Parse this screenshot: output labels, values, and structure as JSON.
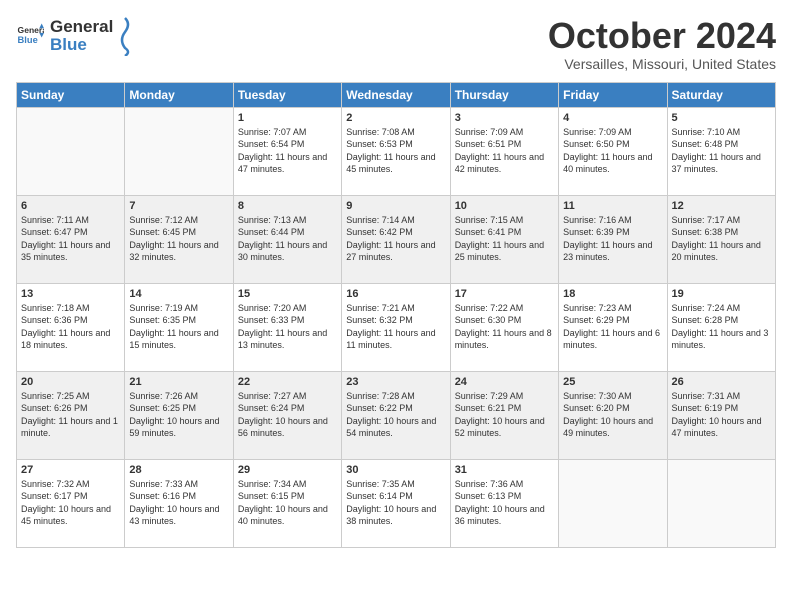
{
  "logo": {
    "general": "General",
    "blue": "Blue"
  },
  "title": "October 2024",
  "location": "Versailles, Missouri, United States",
  "headers": [
    "Sunday",
    "Monday",
    "Tuesday",
    "Wednesday",
    "Thursday",
    "Friday",
    "Saturday"
  ],
  "weeks": [
    [
      {
        "num": "",
        "sunrise": "",
        "sunset": "",
        "daylight": ""
      },
      {
        "num": "",
        "sunrise": "",
        "sunset": "",
        "daylight": ""
      },
      {
        "num": "1",
        "sunrise": "Sunrise: 7:07 AM",
        "sunset": "Sunset: 6:54 PM",
        "daylight": "Daylight: 11 hours and 47 minutes."
      },
      {
        "num": "2",
        "sunrise": "Sunrise: 7:08 AM",
        "sunset": "Sunset: 6:53 PM",
        "daylight": "Daylight: 11 hours and 45 minutes."
      },
      {
        "num": "3",
        "sunrise": "Sunrise: 7:09 AM",
        "sunset": "Sunset: 6:51 PM",
        "daylight": "Daylight: 11 hours and 42 minutes."
      },
      {
        "num": "4",
        "sunrise": "Sunrise: 7:09 AM",
        "sunset": "Sunset: 6:50 PM",
        "daylight": "Daylight: 11 hours and 40 minutes."
      },
      {
        "num": "5",
        "sunrise": "Sunrise: 7:10 AM",
        "sunset": "Sunset: 6:48 PM",
        "daylight": "Daylight: 11 hours and 37 minutes."
      }
    ],
    [
      {
        "num": "6",
        "sunrise": "Sunrise: 7:11 AM",
        "sunset": "Sunset: 6:47 PM",
        "daylight": "Daylight: 11 hours and 35 minutes."
      },
      {
        "num": "7",
        "sunrise": "Sunrise: 7:12 AM",
        "sunset": "Sunset: 6:45 PM",
        "daylight": "Daylight: 11 hours and 32 minutes."
      },
      {
        "num": "8",
        "sunrise": "Sunrise: 7:13 AM",
        "sunset": "Sunset: 6:44 PM",
        "daylight": "Daylight: 11 hours and 30 minutes."
      },
      {
        "num": "9",
        "sunrise": "Sunrise: 7:14 AM",
        "sunset": "Sunset: 6:42 PM",
        "daylight": "Daylight: 11 hours and 27 minutes."
      },
      {
        "num": "10",
        "sunrise": "Sunrise: 7:15 AM",
        "sunset": "Sunset: 6:41 PM",
        "daylight": "Daylight: 11 hours and 25 minutes."
      },
      {
        "num": "11",
        "sunrise": "Sunrise: 7:16 AM",
        "sunset": "Sunset: 6:39 PM",
        "daylight": "Daylight: 11 hours and 23 minutes."
      },
      {
        "num": "12",
        "sunrise": "Sunrise: 7:17 AM",
        "sunset": "Sunset: 6:38 PM",
        "daylight": "Daylight: 11 hours and 20 minutes."
      }
    ],
    [
      {
        "num": "13",
        "sunrise": "Sunrise: 7:18 AM",
        "sunset": "Sunset: 6:36 PM",
        "daylight": "Daylight: 11 hours and 18 minutes."
      },
      {
        "num": "14",
        "sunrise": "Sunrise: 7:19 AM",
        "sunset": "Sunset: 6:35 PM",
        "daylight": "Daylight: 11 hours and 15 minutes."
      },
      {
        "num": "15",
        "sunrise": "Sunrise: 7:20 AM",
        "sunset": "Sunset: 6:33 PM",
        "daylight": "Daylight: 11 hours and 13 minutes."
      },
      {
        "num": "16",
        "sunrise": "Sunrise: 7:21 AM",
        "sunset": "Sunset: 6:32 PM",
        "daylight": "Daylight: 11 hours and 11 minutes."
      },
      {
        "num": "17",
        "sunrise": "Sunrise: 7:22 AM",
        "sunset": "Sunset: 6:30 PM",
        "daylight": "Daylight: 11 hours and 8 minutes."
      },
      {
        "num": "18",
        "sunrise": "Sunrise: 7:23 AM",
        "sunset": "Sunset: 6:29 PM",
        "daylight": "Daylight: 11 hours and 6 minutes."
      },
      {
        "num": "19",
        "sunrise": "Sunrise: 7:24 AM",
        "sunset": "Sunset: 6:28 PM",
        "daylight": "Daylight: 11 hours and 3 minutes."
      }
    ],
    [
      {
        "num": "20",
        "sunrise": "Sunrise: 7:25 AM",
        "sunset": "Sunset: 6:26 PM",
        "daylight": "Daylight: 11 hours and 1 minute."
      },
      {
        "num": "21",
        "sunrise": "Sunrise: 7:26 AM",
        "sunset": "Sunset: 6:25 PM",
        "daylight": "Daylight: 10 hours and 59 minutes."
      },
      {
        "num": "22",
        "sunrise": "Sunrise: 7:27 AM",
        "sunset": "Sunset: 6:24 PM",
        "daylight": "Daylight: 10 hours and 56 minutes."
      },
      {
        "num": "23",
        "sunrise": "Sunrise: 7:28 AM",
        "sunset": "Sunset: 6:22 PM",
        "daylight": "Daylight: 10 hours and 54 minutes."
      },
      {
        "num": "24",
        "sunrise": "Sunrise: 7:29 AM",
        "sunset": "Sunset: 6:21 PM",
        "daylight": "Daylight: 10 hours and 52 minutes."
      },
      {
        "num": "25",
        "sunrise": "Sunrise: 7:30 AM",
        "sunset": "Sunset: 6:20 PM",
        "daylight": "Daylight: 10 hours and 49 minutes."
      },
      {
        "num": "26",
        "sunrise": "Sunrise: 7:31 AM",
        "sunset": "Sunset: 6:19 PM",
        "daylight": "Daylight: 10 hours and 47 minutes."
      }
    ],
    [
      {
        "num": "27",
        "sunrise": "Sunrise: 7:32 AM",
        "sunset": "Sunset: 6:17 PM",
        "daylight": "Daylight: 10 hours and 45 minutes."
      },
      {
        "num": "28",
        "sunrise": "Sunrise: 7:33 AM",
        "sunset": "Sunset: 6:16 PM",
        "daylight": "Daylight: 10 hours and 43 minutes."
      },
      {
        "num": "29",
        "sunrise": "Sunrise: 7:34 AM",
        "sunset": "Sunset: 6:15 PM",
        "daylight": "Daylight: 10 hours and 40 minutes."
      },
      {
        "num": "30",
        "sunrise": "Sunrise: 7:35 AM",
        "sunset": "Sunset: 6:14 PM",
        "daylight": "Daylight: 10 hours and 38 minutes."
      },
      {
        "num": "31",
        "sunrise": "Sunrise: 7:36 AM",
        "sunset": "Sunset: 6:13 PM",
        "daylight": "Daylight: 10 hours and 36 minutes."
      },
      {
        "num": "",
        "sunrise": "",
        "sunset": "",
        "daylight": ""
      },
      {
        "num": "",
        "sunrise": "",
        "sunset": "",
        "daylight": ""
      }
    ]
  ]
}
